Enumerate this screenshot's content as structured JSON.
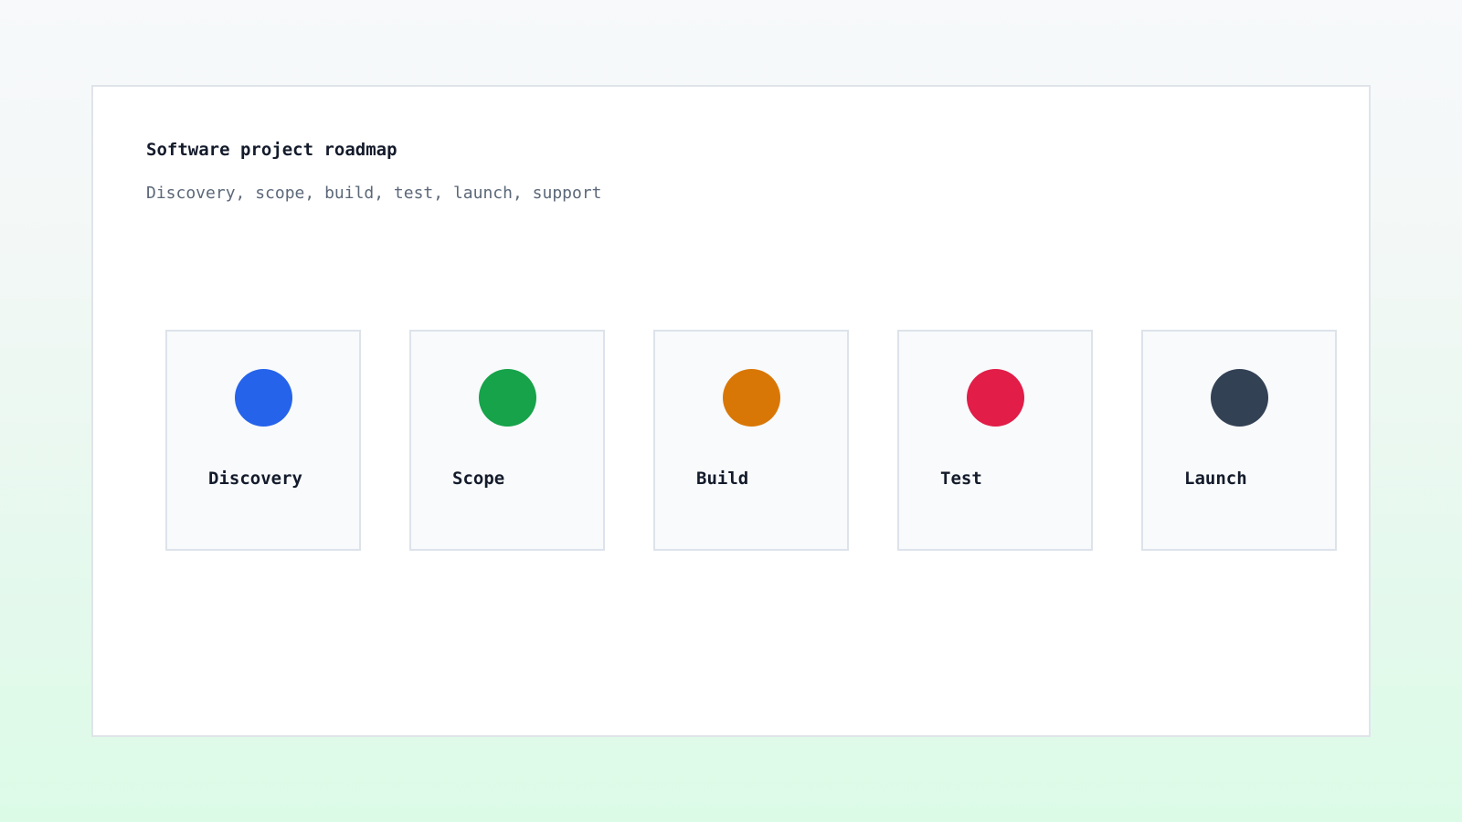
{
  "header": {
    "title": "Software project roadmap",
    "subtitle": "Discovery, scope, build, test, launch, support"
  },
  "stages": [
    {
      "label": "Discovery",
      "color": "#2563eb"
    },
    {
      "label": "Scope",
      "color": "#16a34a"
    },
    {
      "label": "Build",
      "color": "#d97706"
    },
    {
      "label": "Test",
      "color": "#e11d48"
    },
    {
      "label": "Launch",
      "color": "#334155"
    }
  ]
}
